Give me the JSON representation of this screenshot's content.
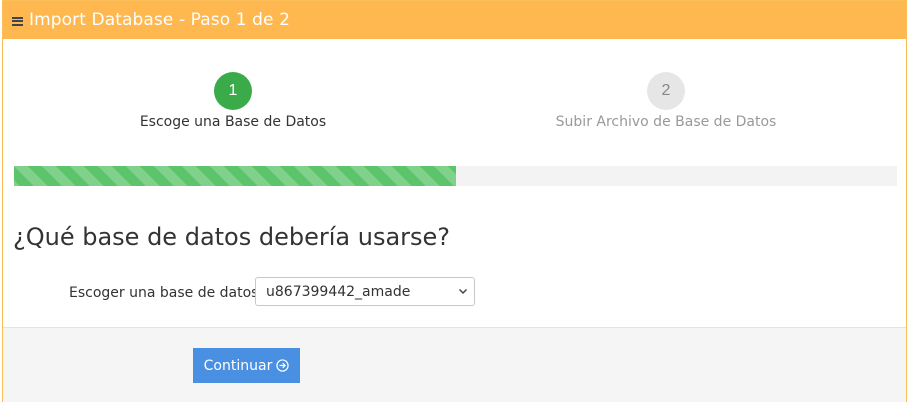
{
  "header": {
    "title": "Import Database - Paso 1 de 2",
    "menu_icon": "hamburger-icon"
  },
  "steps": [
    {
      "number": "1",
      "label": "Escoge una Base de Datos",
      "state": "active"
    },
    {
      "number": "2",
      "label": "Subir Archivo de Base de Datos",
      "state": "inactive"
    }
  ],
  "progress": {
    "percent": 50
  },
  "main": {
    "question": "¿Qué base de datos debería usarse?",
    "select_label": "Escoger una base de datos",
    "select_value": "u867399442_amade"
  },
  "footer": {
    "continue_label": "Continuar",
    "continue_icon": "arrow-right-circle-icon"
  },
  "colors": {
    "header_bg": "#ffb74f",
    "step_active": "#3bab4a",
    "progress_fill": "#5cc46a",
    "button_bg": "#4a90e2"
  }
}
